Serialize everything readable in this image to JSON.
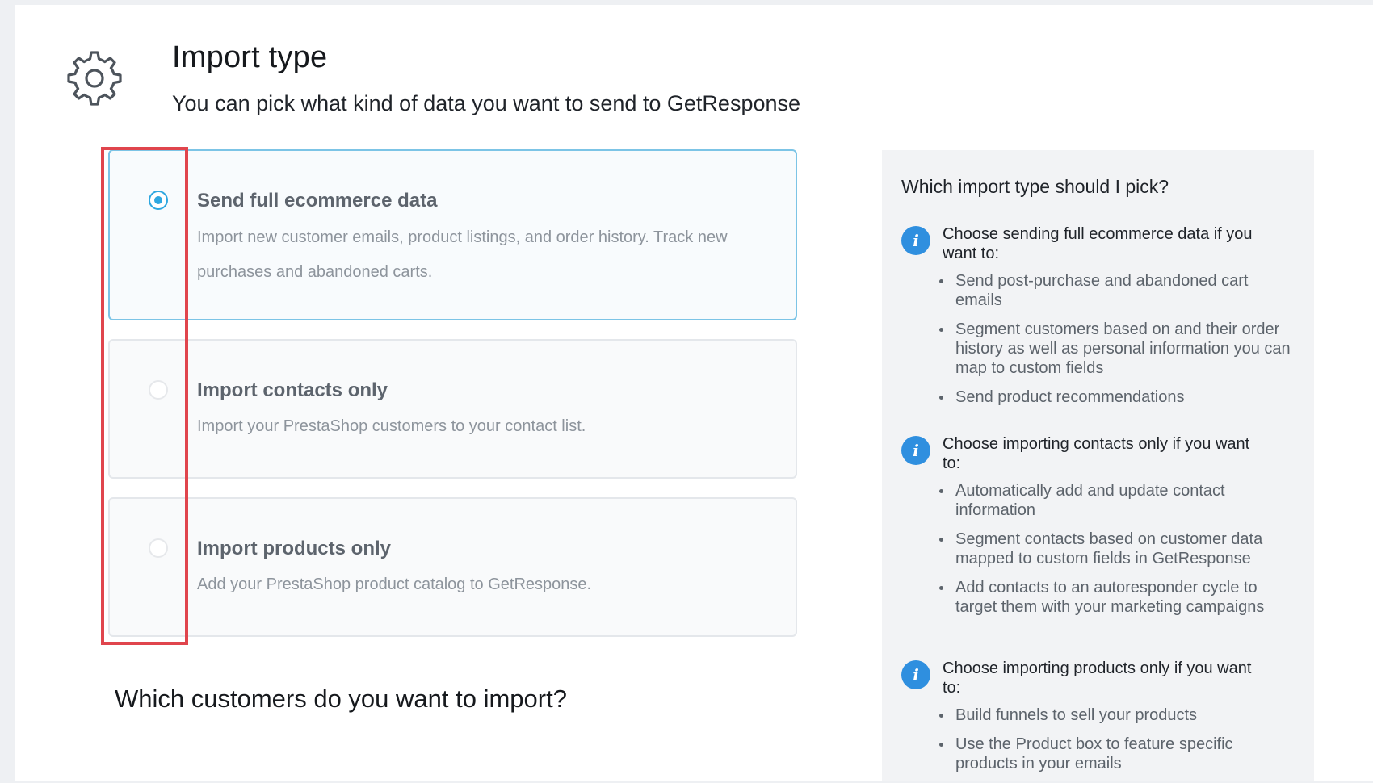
{
  "header": {
    "icon": "gear-icon",
    "title": "Import type",
    "subtitle": "You can pick what kind of data you want to send to GetResponse"
  },
  "options": [
    {
      "title": "Send full ecommerce data",
      "description": "Import new customer emails, product listings, and order history. Track new purchases and abandoned carts.",
      "selected": true
    },
    {
      "title": "Import contacts only",
      "description": "Import your PrestaShop customers to your contact list.",
      "selected": false
    },
    {
      "title": "Import products only",
      "description": "Add your PrestaShop product catalog to GetResponse.",
      "selected": false
    }
  ],
  "section2": {
    "title": "Which customers do you want to import?"
  },
  "help": {
    "title": "Which import type should I pick?",
    "blocks": [
      {
        "icon": "info-icon",
        "heading": "Choose sending full ecommerce data if you want to:",
        "items": [
          "Send post-purchase and abandoned cart emails",
          "Segment customers based on and their order history as well as personal information you can map to custom fields",
          "Send product recommendations"
        ]
      },
      {
        "icon": "info-icon",
        "heading": "Choose importing contacts only if you want to:",
        "items": [
          "Automatically add and update contact information",
          "Segment contacts based on customer data mapped to custom fields in GetResponse",
          "Add contacts to an autoresponder cycle to target them with your marketing campaigns"
        ]
      },
      {
        "icon": "info-icon",
        "heading": "Choose importing products only if you want to:",
        "items": [
          "Build funnels to sell your products",
          "Use the Product box to feature specific products in your emails"
        ]
      }
    ]
  },
  "colors": {
    "accent": "#2ea7e0",
    "info": "#2f8fdf",
    "highlight": "#e0454d"
  }
}
